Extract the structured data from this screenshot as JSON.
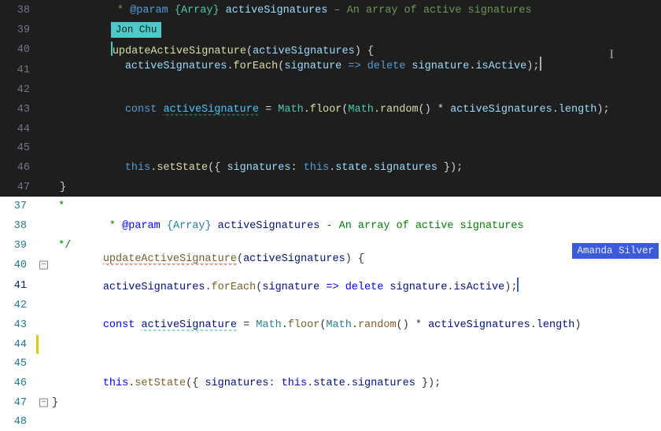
{
  "collaborators": {
    "top": "Jon Chu",
    "bottom": "Amanda Silver"
  },
  "panes": {
    "dark": {
      "lines": {
        "38": {
          "pre": " * ",
          "tag": "@param",
          "type": "{Array}",
          "name": "activeSignatures",
          "dash": " – ",
          "desc": "An array of active signatures"
        },
        "39": "",
        "40": {
          "fn": "updateActiveSignature",
          "args": "activeSignatures"
        },
        "41": {
          "obj": "activeSignatures",
          "method": "forEach",
          "param": "signature",
          "arrow": " => ",
          "kw": "delete",
          "target": "signature",
          "prop": "isActive"
        },
        "42": "",
        "43": {
          "kw": "const",
          "name": "activeSignature",
          "eqcls": "Math",
          "m1": "floor",
          "m2cls": "Math",
          "m2": "random",
          "arr": "activeSignatures",
          "len": "length"
        },
        "44": "",
        "45": "",
        "46": {
          "thiskw": "this",
          "m": "setState",
          "key": "signatures",
          "thiskw2": "this",
          "state": "state",
          "prop": "signatures"
        },
        "47": "}"
      }
    },
    "light": {
      "lines": {
        "37": " *",
        "38": {
          "pre": " * ",
          "tag": "@param",
          "type": "{Array}",
          "name": "activeSignatures",
          "dash": " - ",
          "desc": "An array of active signatures"
        },
        "39": " */",
        "40": {
          "fn": "updateActiveSignature",
          "args": "activeSignatures"
        },
        "41": {
          "obj": "activeSignatures",
          "method": "forEach",
          "param": "signature",
          "arrow": " => ",
          "kw": "delete",
          "target": "signature",
          "prop": "isActive"
        },
        "42": "",
        "43": {
          "kw": "const",
          "name": "activeSignature",
          "eqcls": "Math",
          "m1": "floor",
          "m2cls": "Math",
          "m2": "random",
          "arr": "activeSignatures",
          "len": "length"
        },
        "44": "",
        "45": "",
        "46": {
          "thiskw": "this",
          "m": "setState",
          "key": "signatures",
          "thiskw2": "this",
          "state": "state",
          "prop": "signatures"
        },
        "47": "}",
        "48": ""
      }
    }
  },
  "numbers": {
    "dark": [
      "38",
      "39",
      "40",
      "41",
      "42",
      "43",
      "44",
      "45",
      "46",
      "47"
    ],
    "light": [
      "37",
      "38",
      "39",
      "40",
      "41",
      "42",
      "43",
      "44",
      "45",
      "46",
      "47",
      "48"
    ]
  }
}
